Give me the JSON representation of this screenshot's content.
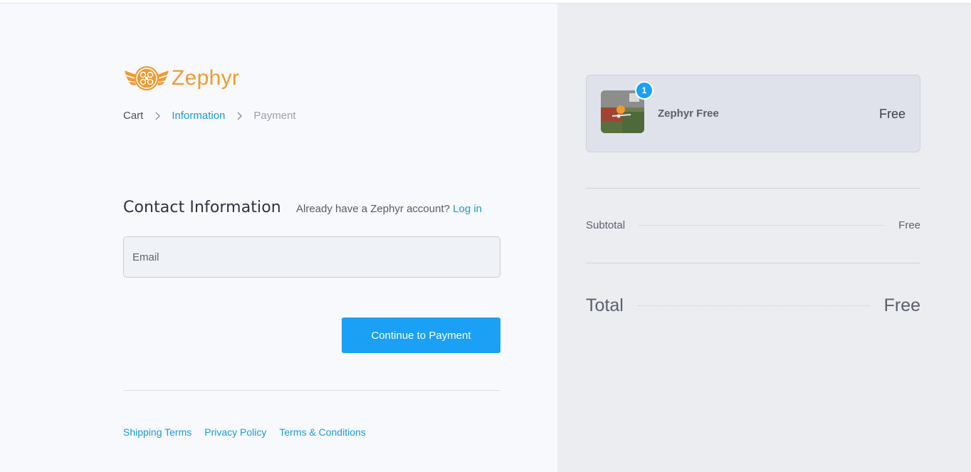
{
  "brand": {
    "name": "Zephyr"
  },
  "breadcrumb": {
    "items": [
      "Cart",
      "Information",
      "Payment"
    ]
  },
  "contact": {
    "title": "Contact Information",
    "account_prompt": "Already have a Zephyr account?",
    "login_label": "Log in",
    "email_placeholder": "Email"
  },
  "actions": {
    "continue_label": "Continue to Payment"
  },
  "footer": {
    "links": [
      "Shipping Terms",
      "Privacy Policy",
      "Terms & Conditions"
    ]
  },
  "summary": {
    "item": {
      "quantity": "1",
      "name": "Zephyr Free",
      "price": "Free"
    },
    "subtotal_label": "Subtotal",
    "subtotal_value": "Free",
    "total_label": "Total",
    "total_value": "Free"
  },
  "colors": {
    "accent": "#1aa0f5",
    "link": "#1a9ad9",
    "brand": "#f29a2e"
  }
}
